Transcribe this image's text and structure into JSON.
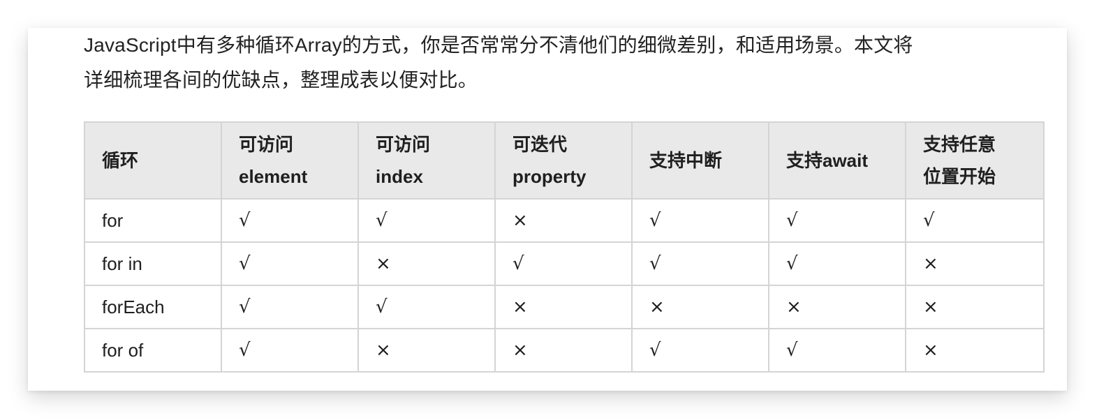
{
  "intro": {
    "line1": "JavaScript中有多种循环Array的方式，你是否常常分不清他们的细微差别，和适用场景。本文将",
    "line2": "详细梳理各间的优缺点，整理成表以便对比。"
  },
  "table": {
    "headers": [
      "循环",
      "可访问\nelement",
      "可访问\nindex",
      "可迭代\nproperty",
      "支持中断",
      "支持await",
      "支持任意\n位置开始"
    ],
    "rows": [
      [
        "for",
        "√",
        "√",
        "×",
        "√",
        "√",
        "√"
      ],
      [
        "for in",
        "√",
        "×",
        "√",
        "√",
        "√",
        "×"
      ],
      [
        "forEach",
        "√",
        "√",
        "×",
        "×",
        "×",
        "×"
      ],
      [
        "for of",
        "√",
        "×",
        "×",
        "√",
        "√",
        "×"
      ]
    ]
  }
}
